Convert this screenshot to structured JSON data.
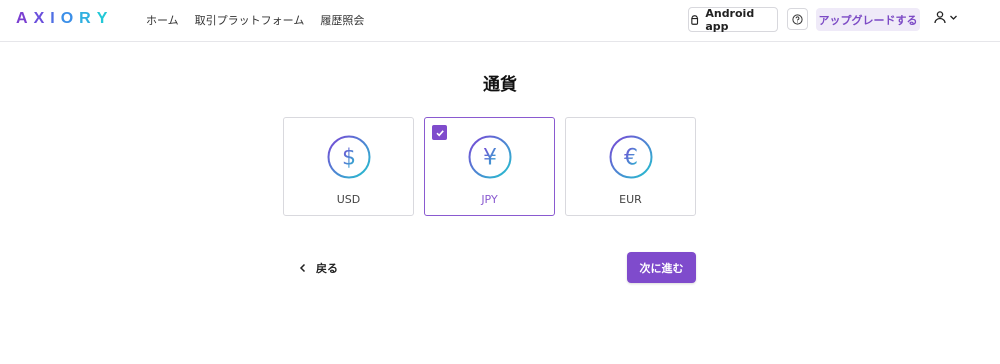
{
  "header": {
    "logo_letters": [
      "A",
      "X",
      "I",
      "O",
      "R",
      "Y"
    ],
    "logo_colors": [
      "#7b3fd1",
      "#6a4fdc",
      "#4f6fe4",
      "#3b8fe8",
      "#2fb0e0",
      "#22c8d6"
    ],
    "nav": [
      {
        "label": "ホーム"
      },
      {
        "label": "取引プラットフォーム"
      },
      {
        "label": "履歴照会"
      }
    ],
    "android_label": "Android app",
    "upgrade_label": "アップグレードする"
  },
  "main": {
    "title": "通貨",
    "currencies": [
      {
        "code": "USD",
        "symbol": "$",
        "selected": false
      },
      {
        "code": "JPY",
        "symbol": "¥",
        "selected": true
      },
      {
        "code": "EUR",
        "symbol": "€",
        "selected": false
      }
    ],
    "back_label": "戻る",
    "next_label": "次に進む"
  },
  "colors": {
    "accent": "#7f4bcc",
    "ring_gradient_start": "#7a45d6",
    "ring_gradient_end": "#22c3cf"
  },
  "icons": {
    "android": "android-icon",
    "help": "help-icon",
    "user": "user-icon",
    "chevron": "chevron-down-icon",
    "back": "chevron-left-icon",
    "check": "check-icon"
  }
}
